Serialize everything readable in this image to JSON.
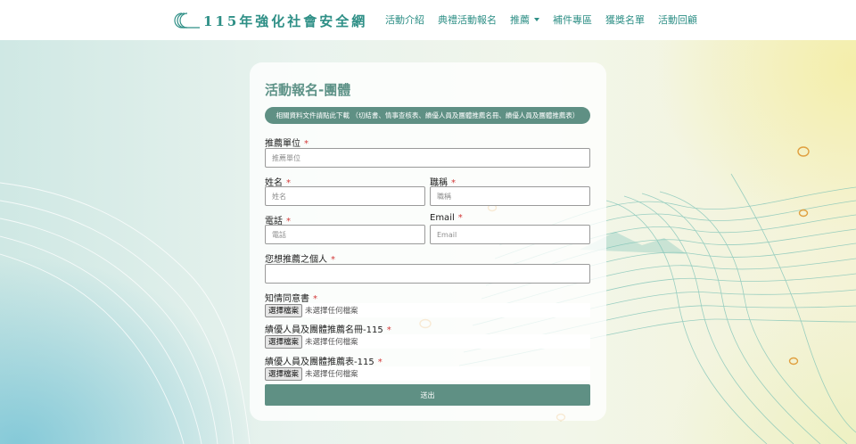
{
  "colors": {
    "brand": "#2e8f86",
    "accent": "#5f9084",
    "required": "#d23838"
  },
  "header": {
    "logo_text": "115年強化社會安全網",
    "nav": [
      {
        "label": "活動介紹"
      },
      {
        "label": "典禮活動報名"
      },
      {
        "label": "推薦",
        "has_dropdown": true
      },
      {
        "label": "補件專區"
      },
      {
        "label": "獲獎名單"
      },
      {
        "label": "活動回顧"
      }
    ]
  },
  "form": {
    "title": "活動報名-團體",
    "docs_link": "相關資料文件請點此下載 （切結書、情事查核表、績優人員及團體推薦名冊、績優人員及團體推薦表）",
    "required_mark": "*",
    "fields": {
      "unit": {
        "label": "推薦單位",
        "placeholder": "推薦單位"
      },
      "name": {
        "label": "姓名",
        "placeholder": "姓名"
      },
      "title": {
        "label": "職稱",
        "placeholder": "職稱"
      },
      "phone": {
        "label": "電話",
        "placeholder": "電話"
      },
      "email": {
        "label": "Email",
        "placeholder": "Email"
      },
      "nominee": {
        "label": "您想推薦之個人",
        "placeholder": ""
      }
    },
    "files": [
      {
        "label": "知情同意書",
        "button": "選擇檔案",
        "status": "未選擇任何檔案"
      },
      {
        "label": "績優人員及團體推薦名冊-115",
        "button": "選擇檔案",
        "status": "未選擇任何檔案"
      },
      {
        "label": "績優人員及團體推薦表-115",
        "button": "選擇檔案",
        "status": "未選擇任何檔案"
      }
    ],
    "submit_label": "送出"
  }
}
